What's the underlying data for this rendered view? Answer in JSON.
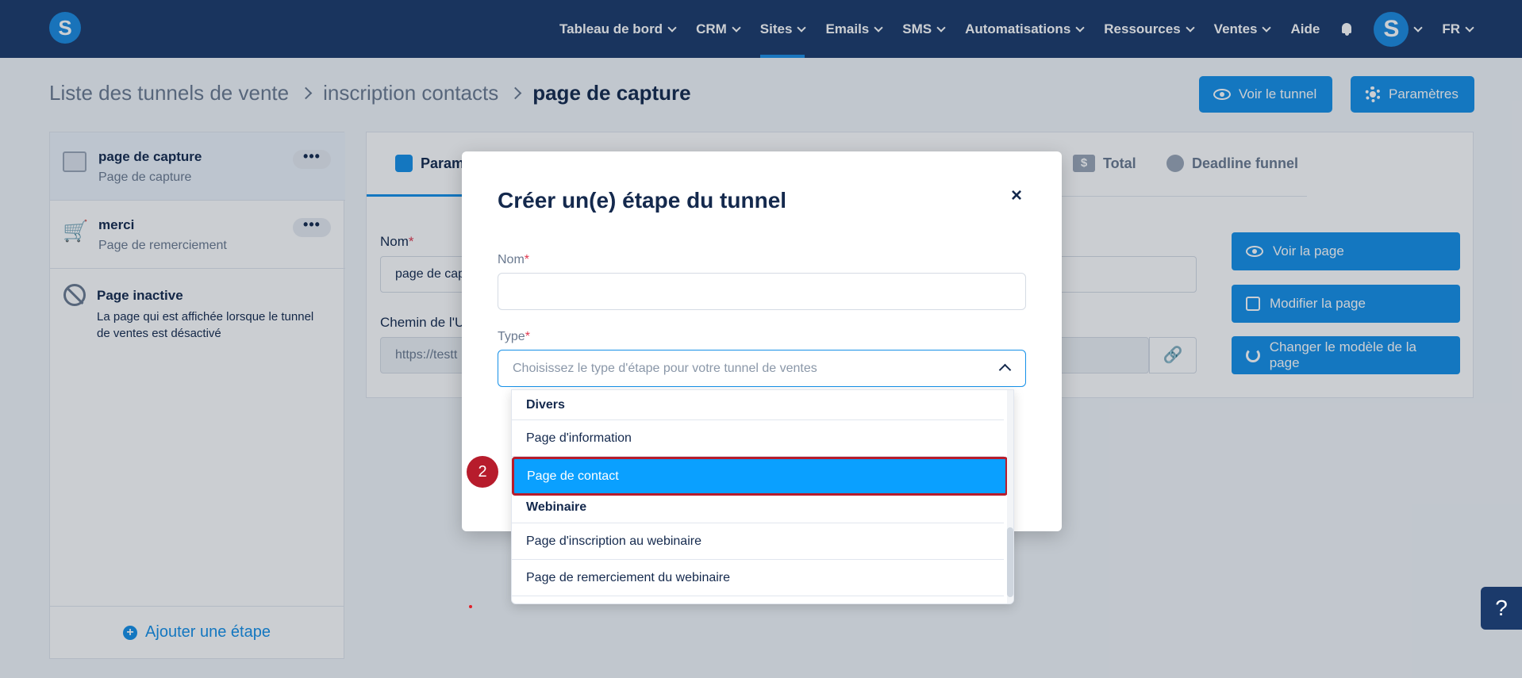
{
  "nav": {
    "items": [
      {
        "label": "Tableau de bord",
        "dropdown": true
      },
      {
        "label": "CRM",
        "dropdown": true
      },
      {
        "label": "Sites",
        "dropdown": true,
        "active": true
      },
      {
        "label": "Emails",
        "dropdown": true
      },
      {
        "label": "SMS",
        "dropdown": true
      },
      {
        "label": "Automatisations",
        "dropdown": true
      },
      {
        "label": "Ressources",
        "dropdown": true
      },
      {
        "label": "Ventes",
        "dropdown": true
      },
      {
        "label": "Aide",
        "dropdown": false
      }
    ],
    "logo_letter": "S",
    "avatar_letter": "S",
    "language": "FR"
  },
  "breadcrumb": {
    "items": [
      "Liste des tunnels de vente",
      "inscription contacts"
    ],
    "current": "page de capture"
  },
  "header_buttons": {
    "view_tunnel": "Voir le tunnel",
    "settings": "Paramètres"
  },
  "steps": [
    {
      "title": "page de capture",
      "subtitle": "Page de capture",
      "more": "•••"
    },
    {
      "title": "merci",
      "subtitle": "Page de remerciement",
      "more": "•••"
    }
  ],
  "inactive_page": {
    "title": "Page inactive",
    "description": "La page qui est affichée lorsque le tunnel de ventes est désactivé"
  },
  "add_step": "Ajouter une étape",
  "main": {
    "tabs": {
      "params": "Param",
      "total": "Total",
      "total_symbol": "$",
      "deadline": "Deadline funnel"
    },
    "name_label": "Nom",
    "name_value": "page de cap",
    "url_label": "Chemin de l'U",
    "url_value": "https://testt",
    "side_buttons": {
      "view_page": "Voir la page",
      "edit_page": "Modifier la page",
      "change_template": "Changer le modèle de la page"
    }
  },
  "modal": {
    "title": "Créer un(e) étape du tunnel",
    "close": "×",
    "name_label": "Nom",
    "type_label": "Type",
    "required_mark": "*",
    "type_placeholder": "Choisissez le type d'étape pour votre tunnel de ventes"
  },
  "dropdown": {
    "groups": [
      {
        "label": "Divers",
        "items": [
          "Page d'information",
          "Page de contact"
        ]
      },
      {
        "label": "Webinaire",
        "items": [
          "Page d'inscription au webinaire",
          "Page de remerciement du webinaire"
        ]
      }
    ],
    "selected": "Page de contact"
  },
  "step_badge": "2",
  "help": "?",
  "colors": {
    "nav_bg": "#1b3a6b",
    "primary": "#1590e8",
    "selected_bg": "#0aa0ff",
    "highlight_border": "#b71c2c"
  }
}
